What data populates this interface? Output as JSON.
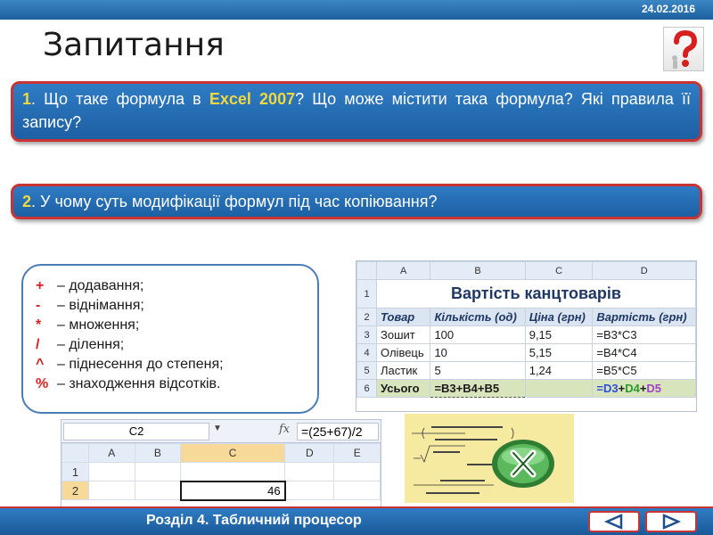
{
  "header": {
    "date": "24.02.2016",
    "title": "Запитання"
  },
  "question1": {
    "num": "1",
    "text_a": ". Що таке формула в ",
    "excel": "Excel 2007",
    "text_b": "? Що може містити така формула? Які правила її запису?"
  },
  "question2": {
    "num": "2",
    "text": ". У чому суть модифікації формул під час копіювання?"
  },
  "operators": [
    {
      "symbol": "+",
      "label": "– додавання;"
    },
    {
      "symbol": "-",
      "label": "– віднімання;"
    },
    {
      "symbol": "*",
      "label": "– множення;"
    },
    {
      "symbol": "/",
      "label": "– ділення;"
    },
    {
      "symbol": "^",
      "label": "– піднесення до степеня;"
    },
    {
      "symbol": "%",
      "label": "– знаходження відсотків."
    }
  ],
  "sheet1": {
    "columns": [
      "A",
      "B",
      "C",
      "D"
    ],
    "title": "Вартість канцтоварів",
    "headers": [
      "Товар",
      "Кількість (од)",
      "Ціна (грн)",
      "Вартість (грн)"
    ],
    "rows": [
      [
        "Зошит",
        "100",
        "9,15",
        "=B3*C3"
      ],
      [
        "Олівець",
        "10",
        "5,15",
        "=B4*C4"
      ],
      [
        "Ластик",
        "5",
        "1,24",
        "=B5*C5"
      ]
    ],
    "total_label": "Усього",
    "total_formula": "=B3+B4+B5",
    "sum_parts": [
      "=D3",
      "+",
      "D4",
      "+",
      "D5"
    ],
    "row_numbers": [
      "1",
      "2",
      "3",
      "4",
      "5",
      "6"
    ]
  },
  "sheet2": {
    "name_box": "C2",
    "fx": "fx",
    "formula": "=(25+67)/2",
    "columns": [
      "A",
      "B",
      "C",
      "D",
      "E"
    ],
    "rows": [
      "1",
      "2"
    ],
    "value": "46"
  },
  "footer": {
    "section": "Розділ 4. Табличний процесор"
  },
  "colors": {
    "bar": "#2f7cc4",
    "border": "#c83434",
    "accent": "#f0d840"
  },
  "icons": [
    "question-mark-icon",
    "excel-logo-icon",
    "prev-arrow-icon",
    "next-arrow-icon"
  ]
}
